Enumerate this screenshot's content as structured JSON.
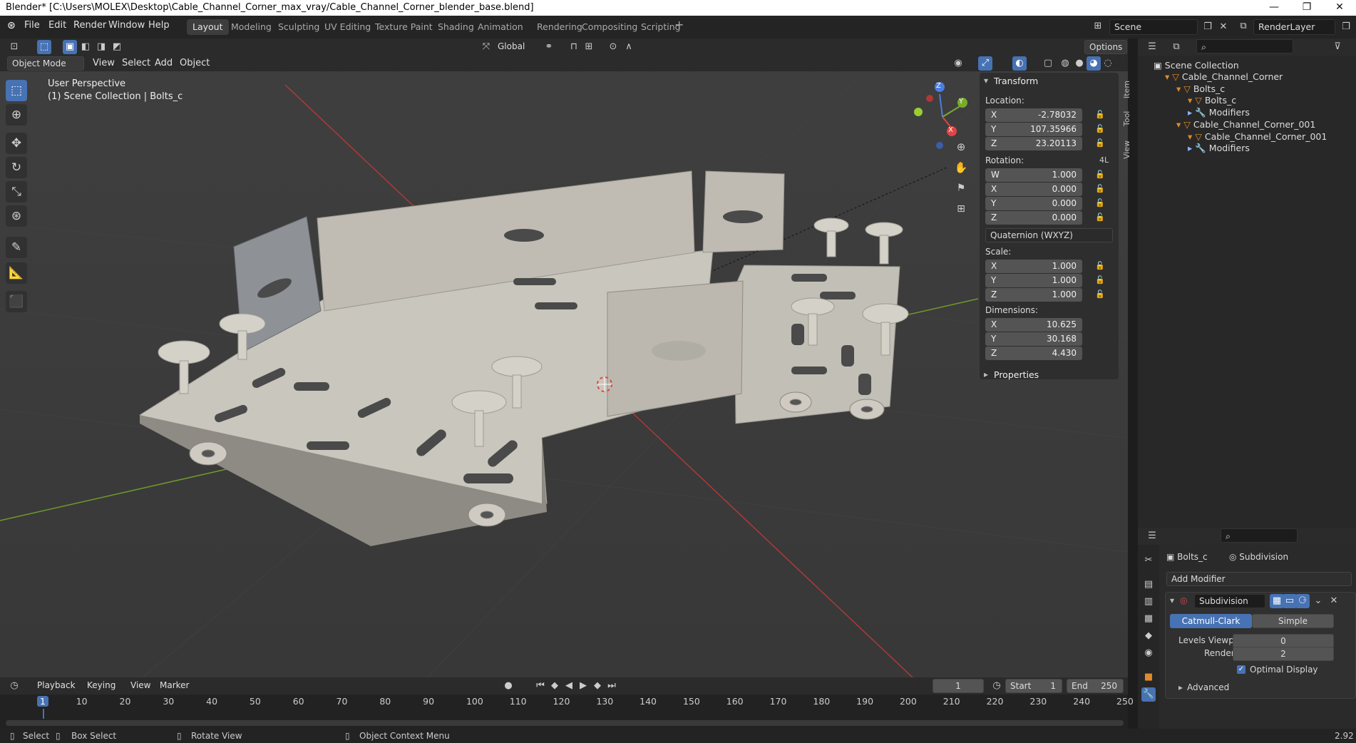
{
  "window": {
    "title": "Blender* [C:\\Users\\MOLEX\\Desktop\\Cable_Channel_Corner_max_vray/Cable_Channel_Corner_blender_base.blend]",
    "minimize": "—",
    "maximize": "❐",
    "close": "✕"
  },
  "menu": {
    "file": "File",
    "edit": "Edit",
    "render": "Render",
    "window": "Window",
    "help": "Help"
  },
  "workspaces": [
    "Layout",
    "Modeling",
    "Sculpting",
    "UV Editing",
    "Texture Paint",
    "Shading",
    "Animation",
    "Rendering",
    "Compositing",
    "Scripting"
  ],
  "scene": {
    "name": "Scene",
    "render_layer": "RenderLayer"
  },
  "viewport_header": {
    "mode": "Object Mode",
    "view": "View",
    "select": "Select",
    "add": "Add",
    "object": "Object",
    "orientation": "Global",
    "options": "Options"
  },
  "viewport": {
    "perspective": "User Perspective",
    "collection": "(1) Scene Collection | Bolts_c"
  },
  "gizmo": {
    "z": "Z",
    "y": "Y",
    "x": "X"
  },
  "npanel": {
    "header": "Transform",
    "location_label": "Location:",
    "location": [
      {
        "axis": "X",
        "value": "-2.78032"
      },
      {
        "axis": "Y",
        "value": "107.35966"
      },
      {
        "axis": "Z",
        "value": "23.20113"
      }
    ],
    "rotation_label": "Rotation:",
    "rotation_mode_short": "4L",
    "rotation": [
      {
        "axis": "W",
        "value": "1.000"
      },
      {
        "axis": "X",
        "value": "0.000"
      },
      {
        "axis": "Y",
        "value": "0.000"
      },
      {
        "axis": "Z",
        "value": "0.000"
      }
    ],
    "rotation_mode": "Quaternion (WXYZ)",
    "scale_label": "Scale:",
    "scale": [
      {
        "axis": "X",
        "value": "1.000"
      },
      {
        "axis": "Y",
        "value": "1.000"
      },
      {
        "axis": "Z",
        "value": "1.000"
      }
    ],
    "dimensions_label": "Dimensions:",
    "dimensions": [
      {
        "axis": "X",
        "value": "10.625"
      },
      {
        "axis": "Y",
        "value": "30.168"
      },
      {
        "axis": "Z",
        "value": "4.430"
      }
    ],
    "properties": "Properties",
    "tabs": [
      "Item",
      "Tool",
      "View"
    ]
  },
  "outliner": {
    "root": "Scene Collection",
    "items": [
      {
        "label": "Cable_Channel_Corner",
        "depth": 0
      },
      {
        "label": "Bolts_c",
        "depth": 1
      },
      {
        "label": "Bolts_c",
        "depth": 2
      },
      {
        "label": "Modifiers",
        "depth": 2
      },
      {
        "label": "Cable_Channel_Corner_001",
        "depth": 1
      },
      {
        "label": "Cable_Channel_Corner_001",
        "depth": 2
      },
      {
        "label": "Modifiers",
        "depth": 2
      }
    ]
  },
  "properties": {
    "object": "Bolts_c",
    "modifier": "Subdivision",
    "add_modifier": "Add Modifier",
    "modifier_name": "Subdivision",
    "catmull": "Catmull-Clark",
    "simple": "Simple",
    "levels_label": "Levels Viewport",
    "levels_value": "0",
    "render_label": "Render",
    "render_value": "2",
    "optimal": "Optimal Display",
    "advanced": "Advanced"
  },
  "timeline": {
    "playback": "Playback",
    "keying": "Keying",
    "view": "View",
    "marker": "Marker",
    "current_frame": "1",
    "start_label": "Start",
    "start": "1",
    "end_label": "End",
    "end": "250",
    "ticks": [
      "1",
      "10",
      "20",
      "30",
      "40",
      "50",
      "60",
      "70",
      "80",
      "90",
      "100",
      "110",
      "120",
      "130",
      "140",
      "150",
      "160",
      "170",
      "180",
      "190",
      "200",
      "210",
      "220",
      "230",
      "240",
      "250"
    ]
  },
  "status": {
    "select": "Select",
    "box_select": "Box Select",
    "rotate_view": "Rotate View",
    "context_menu": "Object Context Menu",
    "version": "2.92"
  },
  "colors": {
    "accent": "#4772b3",
    "grid_red": "#b03838",
    "grid_green": "#6f9a2c",
    "object_fill": "#c9c6bd"
  }
}
